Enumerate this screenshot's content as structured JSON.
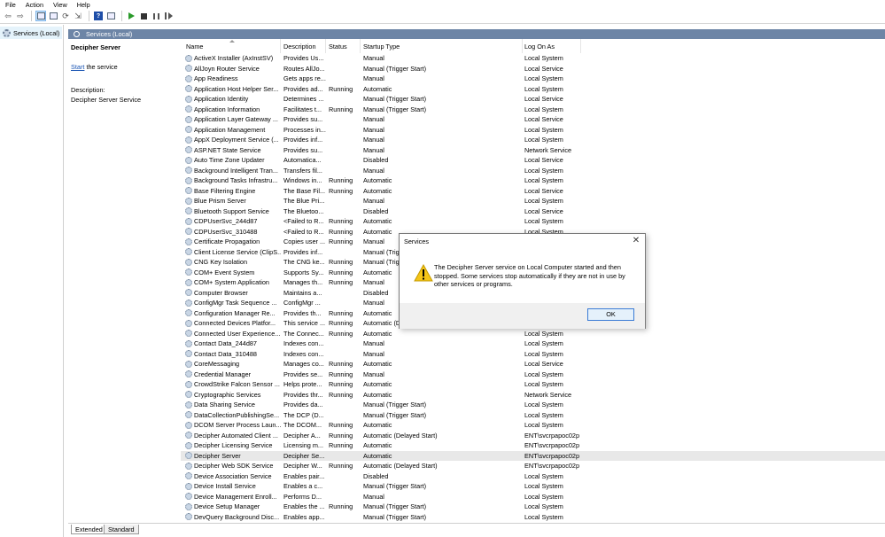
{
  "menu": [
    "File",
    "Action",
    "View",
    "Help"
  ],
  "tree": {
    "label": "Services (Local)"
  },
  "panel": {
    "header": "Services (Local)"
  },
  "detail": {
    "title": "Decipher Server",
    "start_link": "Start",
    "start_rest": " the service",
    "desc_label": "Description:",
    "desc_text": "Decipher Server Service"
  },
  "columns": [
    "Name",
    "Description",
    "Status",
    "Startup Type",
    "Log On As"
  ],
  "rows": [
    [
      "ActiveX Installer (AxInstSV)",
      "Provides Us...",
      "",
      "Manual",
      "Local System"
    ],
    [
      "AllJoyn Router Service",
      "Routes AllJo...",
      "",
      "Manual (Trigger Start)",
      "Local Service"
    ],
    [
      "App Readiness",
      "Gets apps re...",
      "",
      "Manual",
      "Local System"
    ],
    [
      "Application Host Helper Ser...",
      "Provides ad...",
      "Running",
      "Automatic",
      "Local System"
    ],
    [
      "Application Identity",
      "Determines ...",
      "",
      "Manual (Trigger Start)",
      "Local Service"
    ],
    [
      "Application Information",
      "Facilitates t...",
      "Running",
      "Manual (Trigger Start)",
      "Local System"
    ],
    [
      "Application Layer Gateway ...",
      "Provides su...",
      "",
      "Manual",
      "Local Service"
    ],
    [
      "Application Management",
      "Processes in...",
      "",
      "Manual",
      "Local System"
    ],
    [
      "AppX Deployment Service (...",
      "Provides inf...",
      "",
      "Manual",
      "Local System"
    ],
    [
      "ASP.NET State Service",
      "Provides su...",
      "",
      "Manual",
      "Network Service"
    ],
    [
      "Auto Time Zone Updater",
      "Automatica...",
      "",
      "Disabled",
      "Local Service"
    ],
    [
      "Background Intelligent Tran...",
      "Transfers fil...",
      "",
      "Manual",
      "Local System"
    ],
    [
      "Background Tasks Infrastru...",
      "Windows in...",
      "Running",
      "Automatic",
      "Local System"
    ],
    [
      "Base Filtering Engine",
      "The Base Fil...",
      "Running",
      "Automatic",
      "Local Service"
    ],
    [
      "Blue Prism Server",
      "The Blue Pri...",
      "",
      "Manual",
      "Local System"
    ],
    [
      "Bluetooth Support Service",
      "The Bluetoo...",
      "",
      "Disabled",
      "Local Service"
    ],
    [
      "CDPUserSvc_244d87",
      "<Failed to R...",
      "Running",
      "Automatic",
      "Local System"
    ],
    [
      "CDPUserSvc_310488",
      "<Failed to R...",
      "Running",
      "Automatic",
      "Local System"
    ],
    [
      "Certificate Propagation",
      "Copies user ...",
      "Running",
      "Manual",
      ""
    ],
    [
      "Client License Service (ClipS...",
      "Provides inf...",
      "",
      "Manual (Trig",
      ""
    ],
    [
      "CNG Key Isolation",
      "The CNG ke...",
      "Running",
      "Manual (Trig",
      ""
    ],
    [
      "COM+ Event System",
      "Supports Sy...",
      "Running",
      "Automatic",
      ""
    ],
    [
      "COM+ System Application",
      "Manages th...",
      "Running",
      "Manual",
      ""
    ],
    [
      "Computer Browser",
      "Maintains a...",
      "",
      "Disabled",
      ""
    ],
    [
      "ConfigMgr Task Sequence ...",
      "ConfigMgr ...",
      "",
      "Manual",
      ""
    ],
    [
      "Configuration Manager Re...",
      "Provides th...",
      "Running",
      "Automatic",
      ""
    ],
    [
      "Connected Devices Platfor...",
      "This service ...",
      "Running",
      "Automatic (D",
      ""
    ],
    [
      "Connected User Experience...",
      "The Connec...",
      "Running",
      "Automatic",
      "Local System"
    ],
    [
      "Contact Data_244d87",
      "Indexes con...",
      "",
      "Manual",
      "Local System"
    ],
    [
      "Contact Data_310488",
      "Indexes con...",
      "",
      "Manual",
      "Local System"
    ],
    [
      "CoreMessaging",
      "Manages co...",
      "Running",
      "Automatic",
      "Local Service"
    ],
    [
      "Credential Manager",
      "Provides se...",
      "Running",
      "Manual",
      "Local System"
    ],
    [
      "CrowdStrike Falcon Sensor ...",
      "Helps prote...",
      "Running",
      "Automatic",
      "Local System"
    ],
    [
      "Cryptographic Services",
      "Provides thr...",
      "Running",
      "Automatic",
      "Network Service"
    ],
    [
      "Data Sharing Service",
      "Provides da...",
      "",
      "Manual (Trigger Start)",
      "Local System"
    ],
    [
      "DataCollectionPublishingSe...",
      "The DCP (D...",
      "",
      "Manual (Trigger Start)",
      "Local System"
    ],
    [
      "DCOM Server Process Laun...",
      "The DCOM...",
      "Running",
      "Automatic",
      "Local System"
    ],
    [
      "Decipher Automated Client ...",
      "Decipher A...",
      "Running",
      "Automatic (Delayed Start)",
      "ENT\\svcrpapoc02p"
    ],
    [
      "Decipher Licensing Service",
      "Licensing m...",
      "Running",
      "Automatic",
      "ENT\\svcrpapoc02p"
    ],
    [
      "Decipher Server",
      "Decipher Se...",
      "",
      "Automatic",
      "ENT\\svcrpapoc02p"
    ],
    [
      "Decipher Web SDK Service",
      "Decipher W...",
      "Running",
      "Automatic (Delayed Start)",
      "ENT\\svcrpapoc02p"
    ],
    [
      "Device Association Service",
      "Enables pair...",
      "",
      "Disabled",
      "Local System"
    ],
    [
      "Device Install Service",
      "Enables a c...",
      "",
      "Manual (Trigger Start)",
      "Local System"
    ],
    [
      "Device Management Enroll...",
      "Performs D...",
      "",
      "Manual",
      "Local System"
    ],
    [
      "Device Setup Manager",
      "Enables the ...",
      "Running",
      "Manual (Trigger Start)",
      "Local System"
    ],
    [
      "DevQuery Background Disc...",
      "Enables app...",
      "",
      "Manual (Trigger Start)",
      "Local System"
    ]
  ],
  "selected_row": 39,
  "tabs": [
    "Extended",
    "Standard"
  ],
  "dialog": {
    "title": "Services",
    "close": "✕",
    "message": "The Decipher Server service on Local Computer started and then stopped. Some services stop automatically if they are not in use by other services or programs.",
    "ok": "OK"
  }
}
